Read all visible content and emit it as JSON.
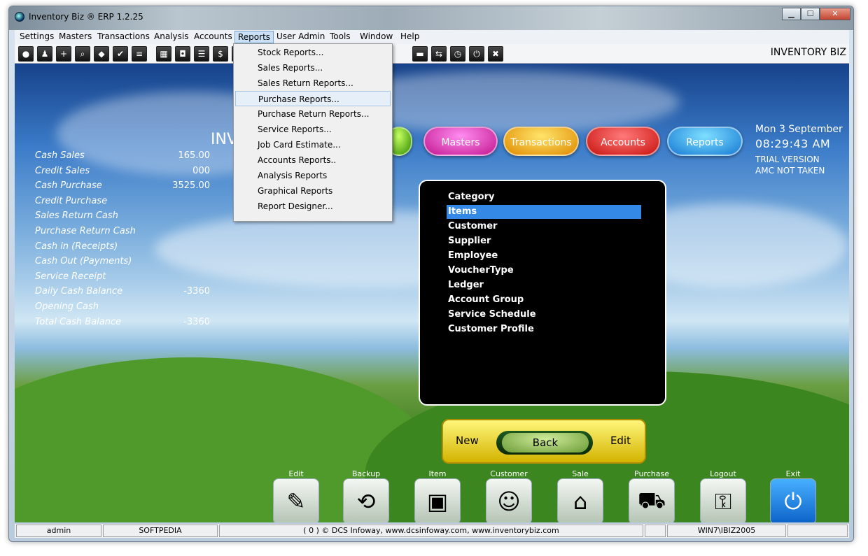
{
  "window": {
    "title": "Inventory Biz ®  ERP 1.2.25",
    "controls": {
      "minimize": "▁",
      "maximize": "☐",
      "close": "✕"
    }
  },
  "menubar": [
    "Settings",
    "Masters",
    "Transactions",
    "Analysis",
    "Accounts",
    "Reports",
    "User Admin",
    "Tools",
    "Window",
    "Help"
  ],
  "toolbar": {
    "brand_label": "INVENTORY BIZ",
    "icons": [
      "settings-icon",
      "user-icon",
      "add-icon",
      "search-icon",
      "chat-icon",
      "check-icon",
      "stack-icon",
      "cart-icon",
      "car-icon",
      "list-icon",
      "money-icon",
      "unknown-icon",
      "print-icon",
      "transfer-icon",
      "clock-icon",
      "power-icon",
      "close-icon"
    ]
  },
  "reports_menu": {
    "items": [
      "Stock Reports...",
      "Sales Reports...",
      "Sales Return Reports...",
      "Purchase Reports...",
      "Purchase Return Reports...",
      "Service Reports...",
      "Job Card Estimate...",
      "Accounts Reports..",
      "Analysis Reports",
      "Graphical Reports",
      "Report Designer..."
    ],
    "hovered_index": 3
  },
  "summary": [
    {
      "label": "Cash Sales",
      "value": "165.00"
    },
    {
      "label": "Credit Sales",
      "value": "000"
    },
    {
      "label": "Cash Purchase",
      "value": "3525.00"
    },
    {
      "label": "Credit Purchase",
      "value": ""
    },
    {
      "label": "Sales Return Cash",
      "value": ""
    },
    {
      "label": "Purchase Return Cash",
      "value": ""
    },
    {
      "label": "Cash in (Receipts)",
      "value": ""
    },
    {
      "label": "Cash Out (Payments)",
      "value": ""
    },
    {
      "label": "Service Receipt",
      "value": ""
    },
    {
      "label": "Daily Cash Balance",
      "value": "-3360"
    },
    {
      "label": "Opening Cash",
      "value": ""
    },
    {
      "label": "Total Cash Balance",
      "value": "-3360"
    }
  ],
  "header_fragment": "INV",
  "nav_pills": {
    "masters": "Masters",
    "transactions": "Transactions",
    "accounts": "Accounts",
    "reports": "Reports"
  },
  "datetime": {
    "date": "Mon 3 September",
    "time": "08:29:43 AM",
    "trial": "TRIAL VERSION",
    "amc": "AMC NOT TAKEN"
  },
  "masters_list": {
    "items": [
      "Category",
      "Items",
      "Customer",
      "Supplier",
      "Employee",
      "VoucherType",
      "Ledger",
      "Account Group",
      "Service Schedule",
      "Customer Profile"
    ],
    "selected_index": 1
  },
  "nav_buttons": {
    "new": "New",
    "back": "Back",
    "edit": "Edit"
  },
  "dock": [
    {
      "label": "Edit",
      "icon": "edit-document-icon"
    },
    {
      "label": "Backup",
      "icon": "backup-icon"
    },
    {
      "label": "Item",
      "icon": "boxes-icon"
    },
    {
      "label": "Customer",
      "icon": "customer-icon"
    },
    {
      "label": "Sale",
      "icon": "basket-icon"
    },
    {
      "label": "Purchase",
      "icon": "cart-icon"
    },
    {
      "label": "Logout",
      "icon": "key-icon"
    },
    {
      "label": "Exit",
      "icon": "power-icon"
    }
  ],
  "statusbar": {
    "user": "admin",
    "company": "SOFTPEDIA",
    "copyright": "( 0 ) © DCS Infoway, www.dcsinfoway.com, www.inventorybiz.com",
    "blank": "",
    "machine": "WIN7\\IBIZ2005"
  }
}
